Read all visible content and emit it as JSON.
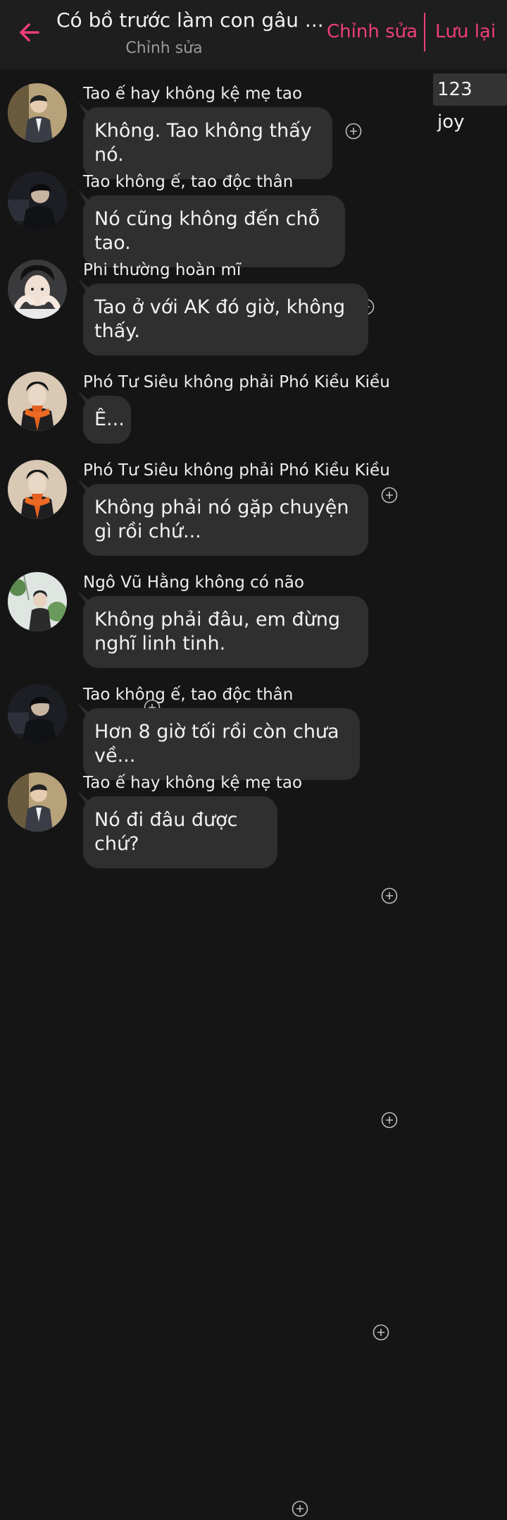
{
  "header": {
    "title": "Có bồ trước làm con gâu ...",
    "subtitle": "Chỉnh sửa",
    "edit_label": "Chỉnh sửa",
    "save_label": "Lưu lại",
    "accent_color": "#ee3d7a"
  },
  "joy_badge": "123 joy",
  "messages": [
    {
      "sender": "Tao ế hay không kệ mẹ tao",
      "text": "Không. Tao không thấy nó.",
      "avatar": "avatar-man-suit"
    },
    {
      "sender": "Tao không ế, tao độc thân",
      "text": "Nó cũng không đến chỗ tao.",
      "avatar": "avatar-dark-figure"
    },
    {
      "sender": "Phi thường hoàn mĩ",
      "text": "Tao ở với AK đó giờ, không thấy.",
      "avatar": "avatar-face-hands"
    },
    {
      "sender": "Phó Tư Siêu không phải Phó Kiều Kiều",
      "text": "Ê...",
      "avatar": "avatar-orange-scarf"
    },
    {
      "sender": "Phó Tư Siêu không phải Phó Kiều Kiều",
      "text": "Không phải nó gặp chuyện gì rồi chứ...",
      "avatar": "avatar-orange-scarf"
    },
    {
      "sender": "Ngô Vũ Hằng không có não",
      "text": "Không phải đâu, em đừng nghĩ linh tinh.",
      "avatar": "avatar-garden"
    },
    {
      "sender": "Tao không ế, tao độc thân",
      "text": "Hơn 8 giờ tối rồi còn chưa về...",
      "avatar": "avatar-dark-figure"
    },
    {
      "sender": "Tao ế hay không kệ mẹ tao",
      "text": "Nó đi đâu được chứ?",
      "avatar": "avatar-man-suit"
    }
  ]
}
